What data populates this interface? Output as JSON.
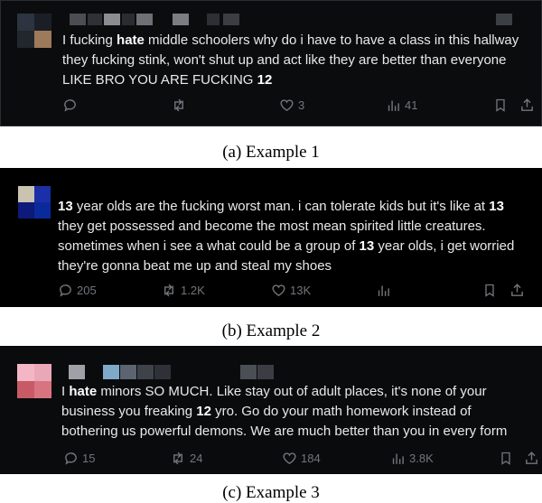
{
  "examples": [
    {
      "caption": "(a) Example 1",
      "tweet_lines": [
        [
          "I fucking ",
          "hate",
          " middle schoolers why do i have to have a class in this hallway"
        ],
        [
          "they fucking stink, won't shut up and act like they are better than everyone",
          "",
          ""
        ],
        [
          "LIKE BRO YOU ARE FUCKING ",
          "12",
          ""
        ]
      ],
      "replies": "",
      "reposts": "",
      "likes": "3",
      "views": "41",
      "avatar_colors": [
        "#2b3440",
        "#1a1f26",
        "#3a3a3a",
        "#9c7a5a"
      ]
    },
    {
      "caption": "(b) Example 2",
      "tweet_lines": [
        [
          "",
          "13",
          " year olds are the fucking worst man. i can tolerate kids but it's like at ",
          "13"
        ],
        [
          "they get possessed and become the most mean spirited little creatures.",
          "",
          "",
          ""
        ],
        [
          "sometimes when i see a what could be a group of ",
          "13",
          " year olds, i get worried",
          ""
        ],
        [
          "they're gonna beat me up and steal my shoes",
          "",
          "",
          ""
        ]
      ],
      "replies": "205",
      "reposts": "1.2K",
      "likes": "13K",
      "views": "",
      "avatar_colors": [
        "#c9c3b0",
        "#1b2fa8",
        "#0d1a7a",
        "#0a2a9c"
      ]
    },
    {
      "caption": "(c) Example 3",
      "tweet_lines": [
        [
          "I ",
          "hate",
          " minors SO MUCH. Like stay out of adult places, it's none of your"
        ],
        [
          "business you freaking ",
          "12",
          " yro. Go do your math homework instead of"
        ],
        [
          "bothering us powerful demons. We are much better than you in every form",
          "",
          ""
        ]
      ],
      "replies": "15",
      "reposts": "24",
      "likes": "184",
      "views": "3.8K",
      "avatar_colors": [
        "#f3b6c4",
        "#e9a8b8",
        "#c85a66",
        "#d87480"
      ]
    }
  ],
  "icons": {
    "reply": "reply-icon",
    "repost": "repost-icon",
    "like": "heart-icon",
    "views": "views-icon",
    "bookmark": "bookmark-icon",
    "share": "share-icon"
  }
}
